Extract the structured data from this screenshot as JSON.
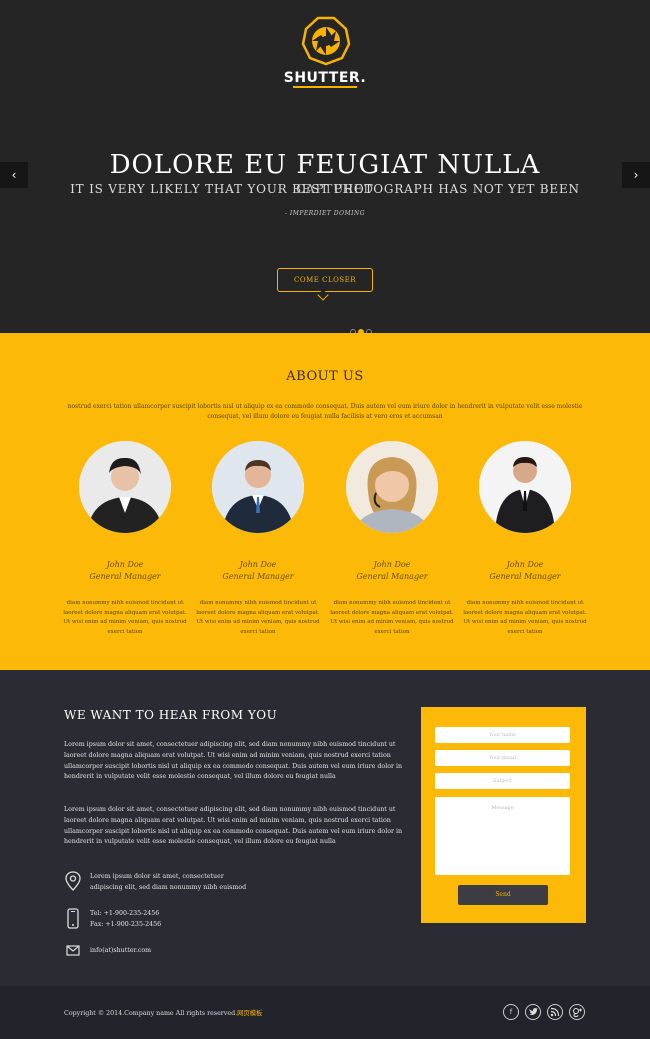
{
  "hero": {
    "brand": "SHUTTER.",
    "title": "DOLORE EU FEUGIAT NULLA",
    "subtitle": "IT IS VERY LIKELY THAT YOUR BEST PHOTOGRAPH HAS NOT YET BEEN",
    "subtitle_overlap": "CAPTURED",
    "quote": "- IMPERDIET DOMING",
    "cta_label": "COME CLOSER",
    "prev_label": "‹",
    "next_label": "›"
  },
  "about": {
    "title": "ABOUT US",
    "text": "nostrud exerci tation ullamcorper suscipit lobortis nisl ut aliquip ex ea commodo consequat. Duis autem vel eum iriure dolor in hendrerit in vulputate velit esse molestie consequat, vel illum dolore eu feugiat nulla facilisis at vero eros et accumsan",
    "members": [
      {
        "name": "John Doe",
        "role": "General Manager",
        "desc": "diam nonummy nibh euismod tincidunt ut laoreet dolore magna aliquam erat volutpat. Ut wisi enim ad minim veniam, quis nostrud exerci tation"
      },
      {
        "name": "John Doe",
        "role": "General Manager",
        "desc": "diam nonummy nibh euismod tincidunt ut laoreet dolore magna aliquam erat volutpat. Ut wisi enim ad minim veniam, quis nostrud exerci tation"
      },
      {
        "name": "John Doe",
        "role": "General Manager",
        "desc": "diam nonummy nibh euismod tincidunt ut laoreet dolore magna aliquam erat volutpat. Ut wisi enim ad minim veniam, quis nostrud exerci tation"
      },
      {
        "name": "John Doe",
        "role": "General Manager",
        "desc": "diam nonummy nibh euismod tincidunt ut laoreet dolore magna aliquam erat volutpat. Ut wisi enim ad minim veniam, quis nostrud exerci tation"
      }
    ]
  },
  "contact": {
    "title": "WE WANT TO HEAR FROM YOU",
    "para1": "Lorem ipsum dolor sit amet, consectetuer adipiscing elit, sed diam nonummy nibh euismod tincidunt ut laoreet dolore magna aliquam erat volutpat. Ut wisi enim ad minim veniam, quis nostrud exerci tation ullamcorper suscipit lobortis nisl ut aliquip ex ea commodo consequat. Duis autem vel eum iriure dolor in hendrerit in vulputate velit esse molestie consequat, vel illum dolore eu feugiat nulla",
    "para2": "Lorem ipsum dolor sit amet, consectetuer adipiscing elit, sed diam nonummy nibh euismod tincidunt ut laoreet dolore magna aliquam erat volutpat. Ut wisi enim ad minim veniam, quis nostrud exerci tation ullamcorper suscipit lobortis nisl ut aliquip ex ea commodo consequat. Duis autem vel eum iriure dolor in hendrerit in vulputate velit esse molestie consequat, vel illum dolore eu feugiat nulla",
    "address_line1": "Lorem ipsum dolor sit amet, consectetuer",
    "address_line2": "adipiscing elit, sed diam nonummy nibh euismod",
    "tel": "Tel: +1-900-235-2456",
    "fax": "Fax: +1-900-235-2456",
    "email": "info(at)shutter.com",
    "form": {
      "name_placeholder": "Your name",
      "email_placeholder": "Your email",
      "subject_placeholder": "Subject",
      "message_placeholder": "Message",
      "send_label": "Send"
    }
  },
  "footer": {
    "copyright": "Copyright © 2014.Company name All rights reserved.",
    "link": "网页模板",
    "social": [
      "f",
      "t",
      "rss",
      "g+"
    ]
  },
  "colors": {
    "accent": "#fcb907",
    "dark": "#252526",
    "contact_bg": "#2b2b34"
  }
}
